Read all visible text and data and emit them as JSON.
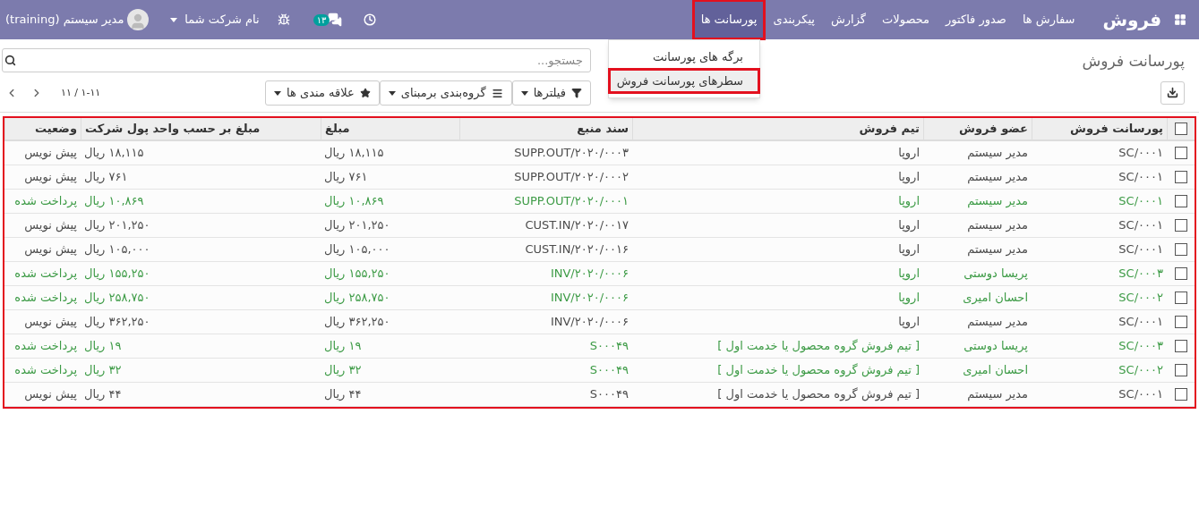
{
  "navbar": {
    "app_name": "فروش",
    "menus": [
      {
        "label": "سفارش ها",
        "selected": false
      },
      {
        "label": "صدور فاکتور",
        "selected": false
      },
      {
        "label": "محصولات",
        "selected": false
      },
      {
        "label": "گزارش",
        "selected": false
      },
      {
        "label": "پیکربندی",
        "selected": false
      },
      {
        "label": "پورسانت ها",
        "selected": true
      }
    ],
    "chat_count": "۱۳",
    "company": "نام شرکت شما",
    "user": "مدیر سیستم (training)"
  },
  "dropdown": {
    "items": [
      {
        "label": "برگه های پورسانت",
        "selected": false
      },
      {
        "label": "سطرهای پورسانت فروش",
        "selected": true
      }
    ]
  },
  "control_panel": {
    "title": "پورسانت فروش",
    "search": {
      "placeholder": "جستجو..."
    },
    "buttons": [
      {
        "label": "فیلترها",
        "kind": "filter"
      },
      {
        "label": "گروه‌بندی برمبنای",
        "kind": "group"
      },
      {
        "label": "علاقه مندی ها",
        "kind": "favorite"
      }
    ],
    "pager": "۱-۱۱ / ۱۱"
  },
  "table": {
    "highlighted": true,
    "all_checked": false,
    "columns": [
      "پورسانت فروش",
      "عضو فروش",
      "تیم فروش",
      "سند منبع",
      "مبلغ",
      "مبلغ بر حسب واحد پول شرکت",
      "وضعیت"
    ],
    "rows": [
      {
        "checked": false,
        "paid": false,
        "cells": [
          "SC/۰۰۰۱",
          "مدیر سیستم",
          "اروپا",
          "SUPP.OUT/۲۰۲۰/۰۰۰۳",
          "۱۸,۱۱۵ ریال",
          "۱۸,۱۱۵ ریال",
          "پیش نویس"
        ]
      },
      {
        "checked": false,
        "paid": false,
        "cells": [
          "SC/۰۰۰۱",
          "مدیر سیستم",
          "اروپا",
          "SUPP.OUT/۲۰۲۰/۰۰۰۲",
          "۷۶۱ ریال",
          "۷۶۱ ریال",
          "پیش نویس"
        ]
      },
      {
        "checked": false,
        "paid": true,
        "cells": [
          "SC/۰۰۰۱",
          "مدیر سیستم",
          "اروپا",
          "SUPP.OUT/۲۰۲۰/۰۰۰۱",
          "۱۰,۸۶۹ ریال",
          "۱۰,۸۶۹ ریال",
          "پرداخت شده"
        ]
      },
      {
        "checked": false,
        "paid": false,
        "cells": [
          "SC/۰۰۰۱",
          "مدیر سیستم",
          "اروپا",
          "CUST.IN/۲۰۲۰/۰۰۱۷",
          "۲۰۱,۲۵۰ ریال",
          "۲۰۱,۲۵۰ ریال",
          "پیش نویس"
        ]
      },
      {
        "checked": false,
        "paid": false,
        "cells": [
          "SC/۰۰۰۱",
          "مدیر سیستم",
          "اروپا",
          "CUST.IN/۲۰۲۰/۰۰۱۶",
          "۱۰۵,۰۰۰ ریال",
          "۱۰۵,۰۰۰ ریال",
          "پیش نویس"
        ]
      },
      {
        "checked": false,
        "paid": true,
        "cells": [
          "SC/۰۰۰۳",
          "پریسا دوستی",
          "اروپا",
          "INV/۲۰۲۰/۰۰۰۶",
          "۱۵۵,۲۵۰ ریال",
          "۱۵۵,۲۵۰ ریال",
          "پرداخت شده"
        ]
      },
      {
        "checked": false,
        "paid": true,
        "cells": [
          "SC/۰۰۰۲",
          "احسان امیری",
          "اروپا",
          "INV/۲۰۲۰/۰۰۰۶",
          "۲۵۸,۷۵۰ ریال",
          "۲۵۸,۷۵۰ ریال",
          "پرداخت شده"
        ]
      },
      {
        "checked": false,
        "paid": false,
        "cells": [
          "SC/۰۰۰۱",
          "مدیر سیستم",
          "اروپا",
          "INV/۲۰۲۰/۰۰۰۶",
          "۳۶۲,۲۵۰ ریال",
          "۳۶۲,۲۵۰ ریال",
          "پیش نویس"
        ]
      },
      {
        "checked": false,
        "paid": true,
        "cells": [
          "SC/۰۰۰۳",
          "پریسا دوستی",
          "[ تیم فروش گروه محصول یا خدمت اول ]",
          "S۰۰۰۴۹",
          "۱۹ ریال",
          "۱۹ ریال",
          "پرداخت شده"
        ]
      },
      {
        "checked": false,
        "paid": true,
        "cells": [
          "SC/۰۰۰۲",
          "احسان امیری",
          "[ تیم فروش گروه محصول یا خدمت اول ]",
          "S۰۰۰۴۹",
          "۳۲ ریال",
          "۳۲ ریال",
          "پرداخت شده"
        ]
      },
      {
        "checked": false,
        "paid": false,
        "cells": [
          "SC/۰۰۰۱",
          "مدیر سیستم",
          "[ تیم فروش گروه محصول یا خدمت اول ]",
          "S۰۰۰۴۹",
          "۴۴ ریال",
          "۴۴ ریال",
          "پیش نویس"
        ]
      }
    ]
  }
}
